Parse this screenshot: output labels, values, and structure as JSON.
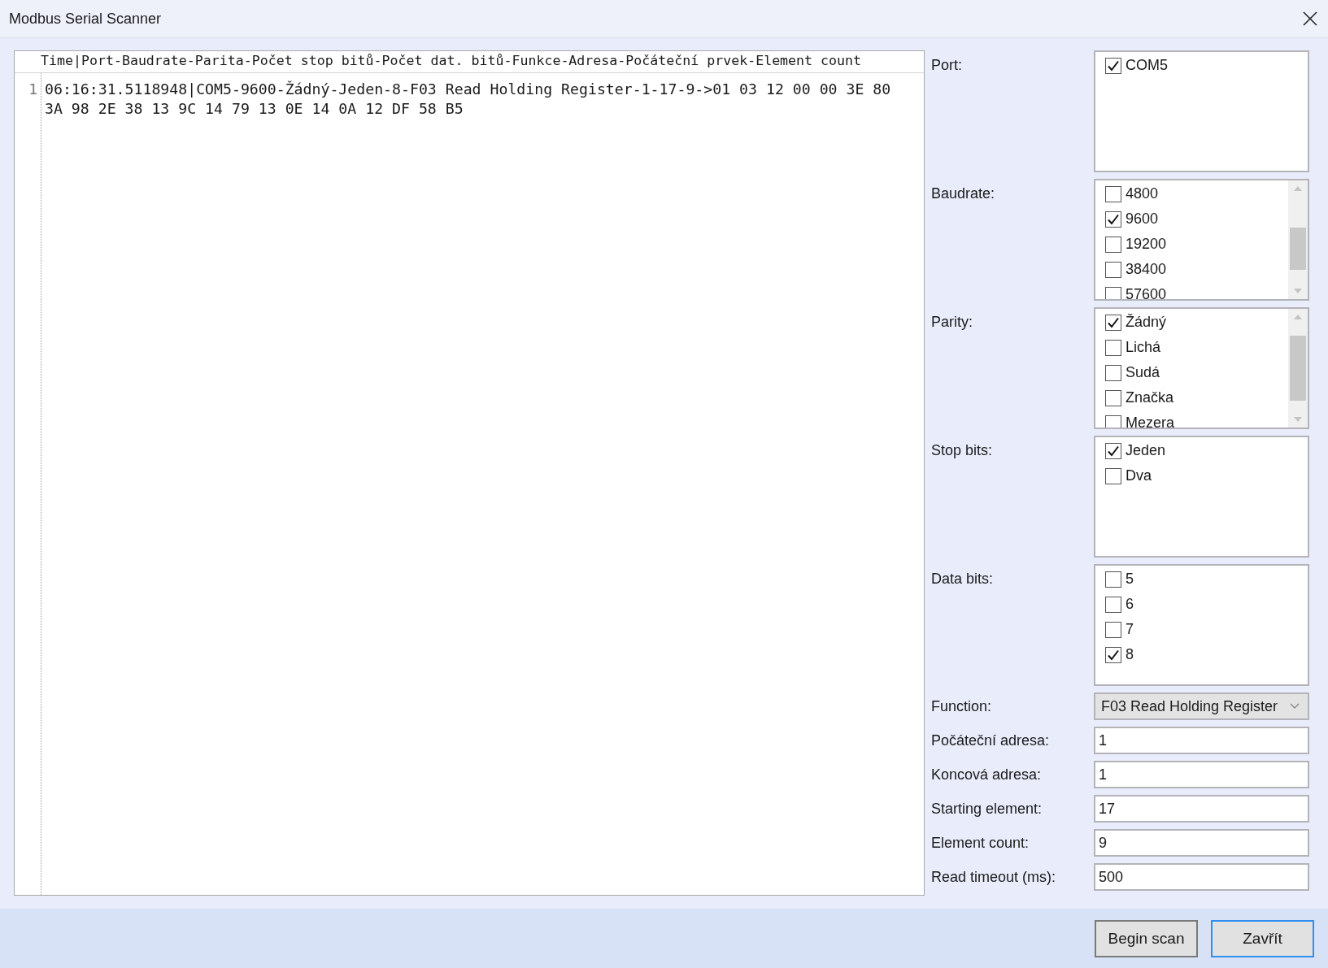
{
  "window": {
    "title": "Modbus Serial Scanner"
  },
  "log": {
    "header": "Time|Port-Baudrate-Parita-Počet stop bitů-Počet dat. bitů-Funkce-Adresa-Počáteční prvek-Element count",
    "lines": [
      {
        "number": "1",
        "text": "06:16:31.5118948|COM5-9600-Žádný-Jeden-8-F03 Read Holding Register-1-17-9->01 03 12 00 00 3E 80 3A 98 2E 38 13 9C 14 79 13 0E 14 0A 12 DF 58 B5"
      }
    ]
  },
  "settings": [
    {
      "kind": "checklist",
      "label": "Port:",
      "scrollbar": false,
      "options": [
        {
          "label": "COM5",
          "checked": true
        }
      ]
    },
    {
      "kind": "checklist",
      "label": "Baudrate:",
      "scrollbar": true,
      "options": [
        {
          "label": "4800",
          "checked": false
        },
        {
          "label": "9600",
          "checked": true
        },
        {
          "label": "19200",
          "checked": false
        },
        {
          "label": "38400",
          "checked": false
        },
        {
          "label": "57600",
          "checked": false
        }
      ]
    },
    {
      "kind": "checklist",
      "label": "Parity:",
      "scrollbar": true,
      "options": [
        {
          "label": "Žádný",
          "checked": true
        },
        {
          "label": "Lichá",
          "checked": false
        },
        {
          "label": "Sudá",
          "checked": false
        },
        {
          "label": "Značka",
          "checked": false
        },
        {
          "label": "Mezera",
          "checked": false
        }
      ]
    },
    {
      "kind": "checklist",
      "label": "Stop bits:",
      "scrollbar": false,
      "options": [
        {
          "label": "Jeden",
          "checked": true
        },
        {
          "label": "Dva",
          "checked": false
        }
      ]
    },
    {
      "kind": "checklist",
      "label": "Data bits:",
      "scrollbar": false,
      "options": [
        {
          "label": "5",
          "checked": false
        },
        {
          "label": "6",
          "checked": false
        },
        {
          "label": "7",
          "checked": false
        },
        {
          "label": "8",
          "checked": true
        }
      ]
    },
    {
      "kind": "dropdown",
      "label": "Function:",
      "value": "F03 Read Holding Register"
    },
    {
      "kind": "field",
      "label": "Počáteční adresa:",
      "value": "1"
    },
    {
      "kind": "field",
      "label": "Koncová adresa:",
      "value": "1"
    },
    {
      "kind": "field",
      "label": "Starting element:",
      "value": "17"
    },
    {
      "kind": "field",
      "label": "Element count:",
      "value": "9"
    },
    {
      "kind": "field",
      "label": "Read timeout (ms):",
      "value": "500"
    }
  ],
  "buttons": [
    {
      "label": "Begin scan",
      "focused": false
    },
    {
      "label": "Zavřít",
      "focused": true
    }
  ]
}
